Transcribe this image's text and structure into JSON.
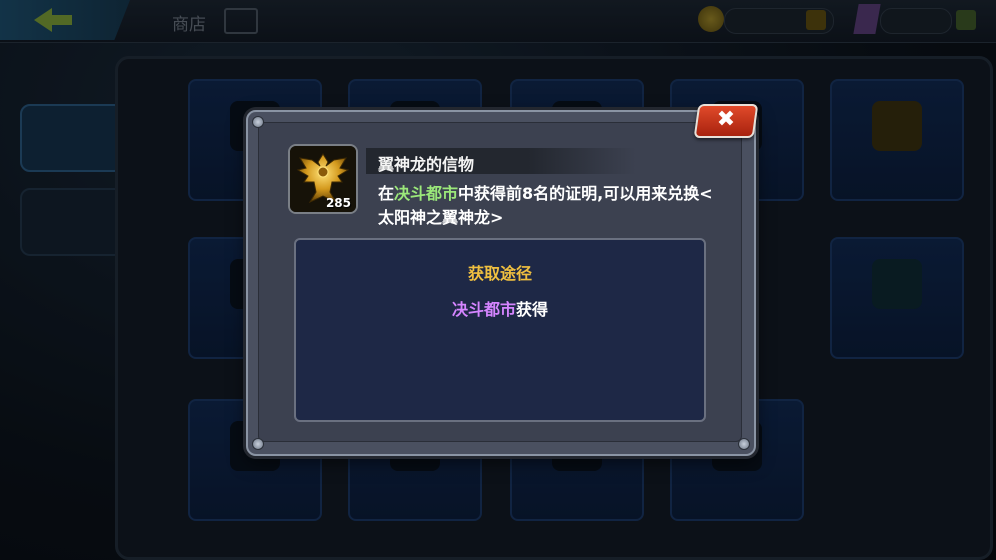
{
  "colors": {
    "highlight_green": "#9be87a",
    "highlight_purple": "#d585ff",
    "source_title": "#f0c040",
    "close_button": "#c8321a",
    "modal_frame": "#4a5060",
    "source_box": "#1e2846"
  },
  "dialog": {
    "close_icon": "✖",
    "item": {
      "icon": "golden-eagle-emblem-icon",
      "count": "285",
      "name": "翼神龙的信物",
      "desc_prefix": "在",
      "desc_location": "决斗都市",
      "desc_suffix": "中获得前8名的证明,可以用来兑换<太阳神之翼神龙>"
    },
    "source": {
      "title": "获取途径",
      "location": "决斗都市",
      "suffix": "获得"
    }
  },
  "background": {
    "header_title": "商店"
  }
}
